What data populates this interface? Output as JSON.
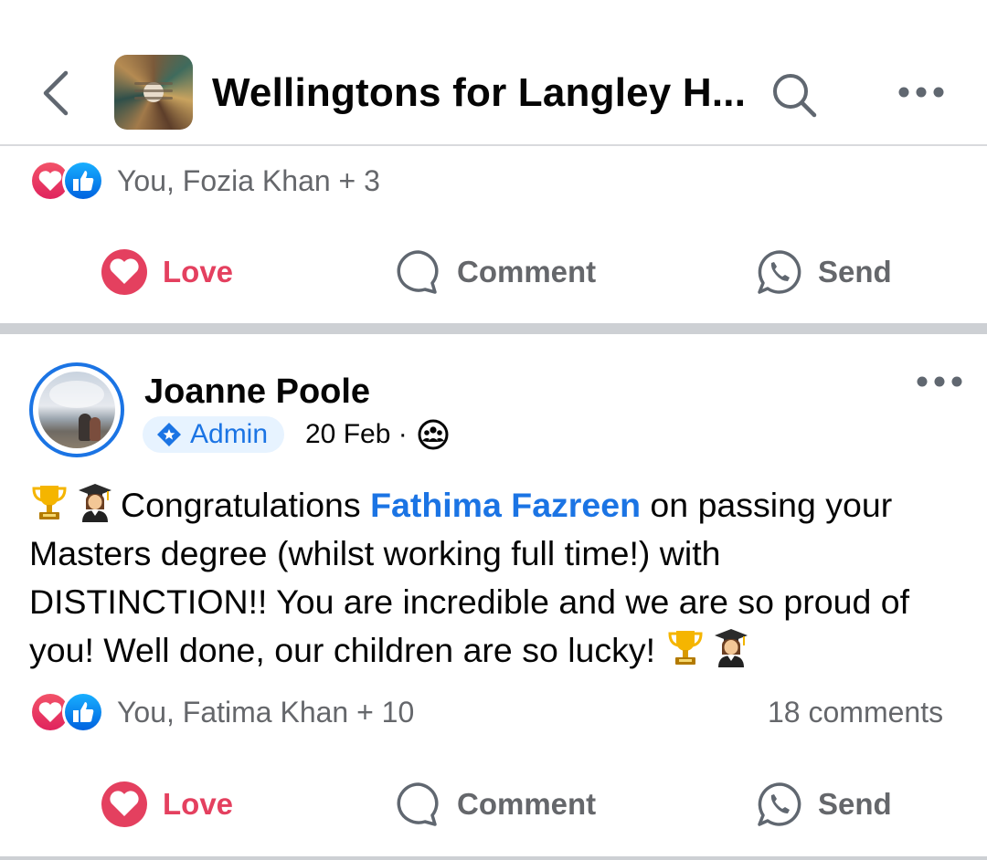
{
  "header": {
    "title": "Wellingtons for Langley H...",
    "group_image_icon": "group-cover-image"
  },
  "previous_post": {
    "reactions_text": "You, Fozia Khan + 3",
    "actions": {
      "love": "Love",
      "comment": "Comment",
      "send": "Send"
    }
  },
  "post": {
    "author": "Joanne Poole",
    "badge": "Admin",
    "date": "20 Feb ·",
    "visibility_icon": "group-members-icon",
    "body_before": "Congratulations ",
    "mention": "Fathima Fazreen",
    "body_after": " on passing your Masters degree (whilst working full time!) with DISTINCTION!! You are incredible and we are so proud of you! Well done, our children are so lucky! ",
    "reactions_text": "You, Fatima Khan + 10",
    "comments_count": "18 comments",
    "actions": {
      "love": "Love",
      "comment": "Comment",
      "send": "Send"
    }
  },
  "colors": {
    "accent_blue": "#1b74e4",
    "love_red": "#e4405f",
    "secondary_text": "#65676b",
    "divider": "#cdd0d4"
  }
}
